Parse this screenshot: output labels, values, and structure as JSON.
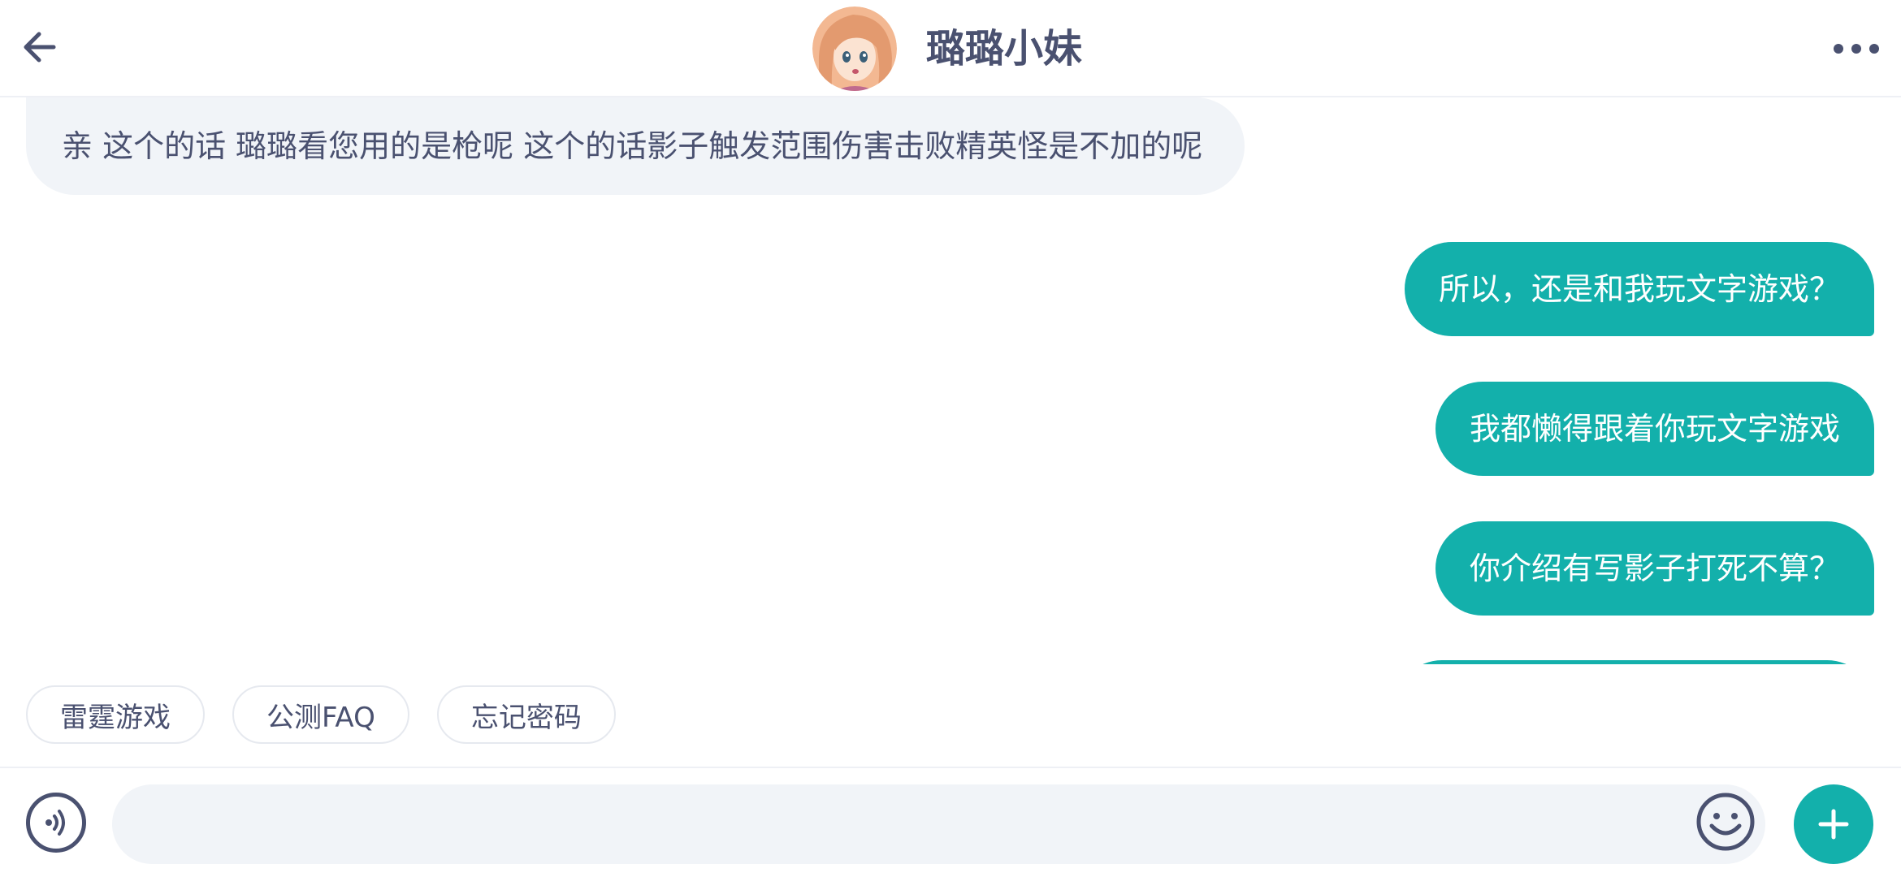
{
  "header": {
    "title": "璐璐小妹",
    "back_icon": "arrow-left-icon",
    "more_icon": "more-horizontal-icon",
    "avatar_icon": "anime-girl-avatar"
  },
  "messages": [
    {
      "side": "incoming",
      "text": "亲 这个的话 璐璐看您用的是枪呢 这个的话影子触发范围伤害击败精英怪是不加的呢"
    },
    {
      "side": "outgoing",
      "text": "所以，还是和我玩文字游戏？"
    },
    {
      "side": "outgoing",
      "text": "我都懒得跟着你玩文字游戏"
    },
    {
      "side": "outgoing",
      "text": "你介绍有写影子打死不算？"
    }
  ],
  "quick_replies": [
    "雷霆游戏",
    "公测FAQ",
    "忘记密码"
  ],
  "input": {
    "value": "",
    "placeholder": "",
    "voice_icon": "voice-wave-icon",
    "emoji_icon": "smiley-face-icon",
    "plus_icon": "plus-icon"
  },
  "colors": {
    "accent": "#13b0ab",
    "text_dark": "#4a5170",
    "bubble_incoming": "#f1f4f8",
    "divider": "#eef0f5"
  }
}
